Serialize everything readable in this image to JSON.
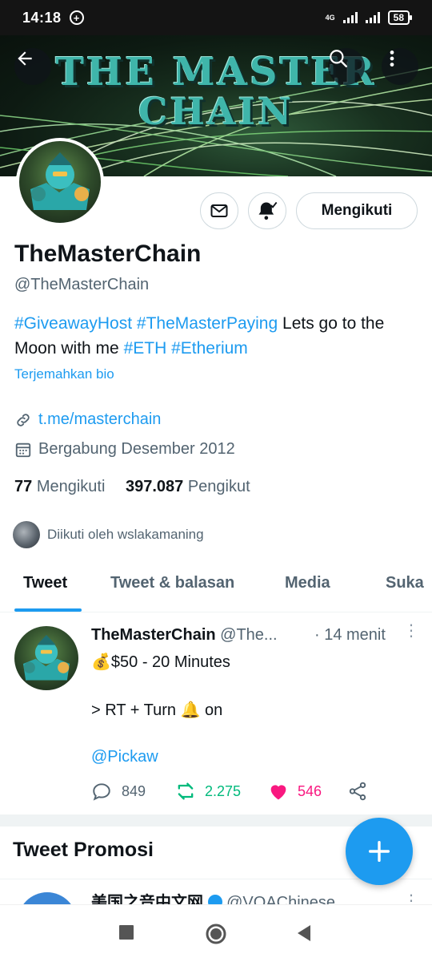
{
  "status_bar": {
    "time": "14:18",
    "network": "4G",
    "battery": "58"
  },
  "banner": {
    "title_line1": "THE MASTER",
    "title_line2": "CHAIN"
  },
  "profile": {
    "name": "TheMasterChain",
    "handle": "@TheMasterChain",
    "follow_button": "Mengikuti",
    "bio": {
      "tag1": "#GiveawayHost",
      "tag2": "#TheMasterPaying",
      "text1": "Lets go to the",
      "text2": "Moon with me",
      "tag3": "#ETH",
      "tag4": "#Etherium"
    },
    "translate_bio": "Terjemahkan bio",
    "link": "t.me/masterchain",
    "joined": "Bergabung Desember 2012",
    "following_count": "77",
    "following_label": "Mengikuti",
    "followers_count": "397.087",
    "followers_label": "Pengikut",
    "followed_by": "Diikuti oleh wslakamaning"
  },
  "tabs": [
    {
      "label": "Tweet"
    },
    {
      "label": "Tweet & balasan"
    },
    {
      "label": "Media"
    },
    {
      "label": "Suka"
    }
  ],
  "tweet": {
    "name": "TheMasterChain",
    "handle": "@The...",
    "time": "· 14 menit",
    "line1": "💰$50 - 20 Minutes",
    "line2": "> RT + Turn 🔔 on",
    "line3": "@Pickaw",
    "replies": "849",
    "retweets": "2.275",
    "likes": "546"
  },
  "promo": {
    "title": "Tweet Promosi",
    "next_name": "美国之音中文网",
    "next_handle": "@VOAChinese"
  },
  "colors": {
    "accent": "#1d9bf0",
    "retweet": "#00ba7c",
    "like": "#f91880",
    "text": "#0f1419",
    "muted": "#536471"
  },
  "icons": {
    "back": "arrow-left-icon",
    "search": "search-icon",
    "more": "more-vertical-icon",
    "message": "envelope-icon",
    "notify": "bell-check-icon",
    "link": "link-icon",
    "calendar": "calendar-icon",
    "reply": "reply-icon",
    "retweet": "retweet-icon",
    "like": "heart-icon",
    "share": "share-icon",
    "compose": "plus-icon"
  }
}
